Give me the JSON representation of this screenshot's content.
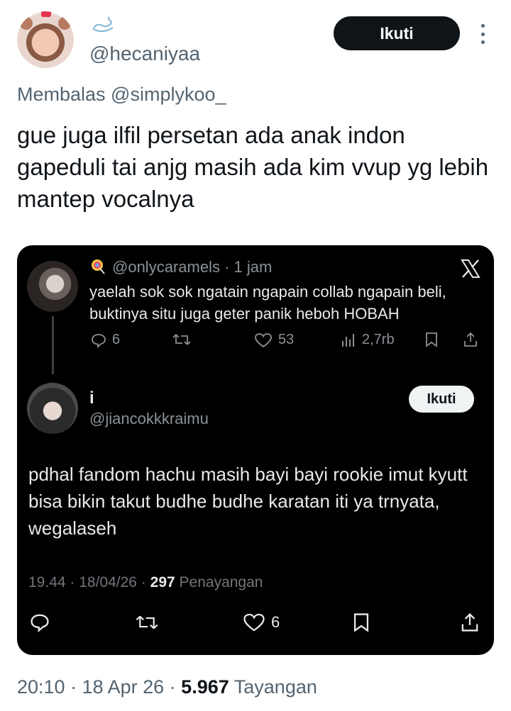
{
  "author": {
    "handle": "@hecaniyaa",
    "follow_label": "Ikuti"
  },
  "reply_context": "Membalas @simplykoo_",
  "tweet_text": "gue juga ilfil persetan ada anak indon gapeduli tai anjg masih ada kim vvup yg lebih mantep vocalnya",
  "embed": {
    "quoted_post": {
      "user_line": "@onlycaramels · 1 jam",
      "text": "yaelah sok sok ngatain ngapain collab ngapain beli, buktinya situ juga geter panik heboh HOBAH",
      "replies": "6",
      "likes": "53",
      "views": "2,7rb"
    },
    "reply_post": {
      "name": "i",
      "handle": "@jiancokkkraimu",
      "follow_label": "Ikuti",
      "text": "pdhal fandom hachu masih bayi bayi rookie imut kyutt bisa bikin takut budhe budhe karatan iti ya trnyata, wegalaseh",
      "timestamp": "19.44 · 18/04/26 ·",
      "views_count": "297",
      "views_label": "Penayangan",
      "likes": "6"
    }
  },
  "footer": {
    "timestamp": "20:10 · 18 Apr 26 ·",
    "views_count": "5.967",
    "views_label": "Tayangan"
  },
  "colors": {
    "accent_dark": "#0f1419",
    "secondary_text": "#536471",
    "embed_bg": "#000000"
  },
  "icons": [
    "swan-icon",
    "more-icon",
    "lollipop-icon",
    "x-logo-icon",
    "reply-icon",
    "retweet-icon",
    "like-icon",
    "views-icon",
    "bookmark-icon",
    "share-icon"
  ]
}
